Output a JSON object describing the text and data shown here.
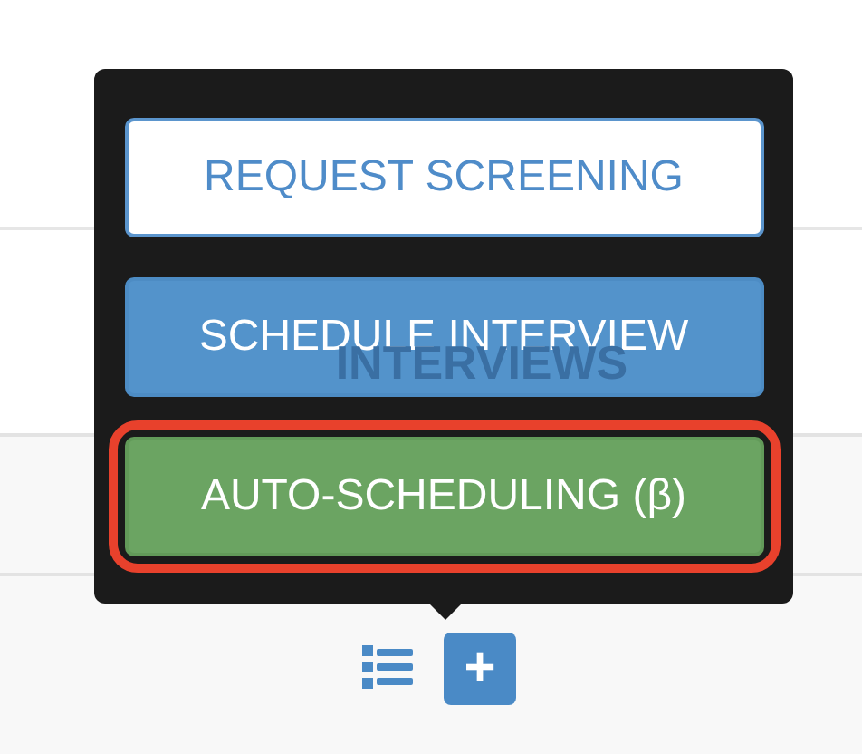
{
  "background": {
    "heading": "INTERVIEWS"
  },
  "popover": {
    "buttons": [
      {
        "label": "REQUEST SCREENING",
        "kind": "outline",
        "highlighted": false
      },
      {
        "label": "SCHEDULE INTERVIEW",
        "kind": "primary",
        "highlighted": false
      },
      {
        "label": "AUTO-SCHEDULING (β)",
        "kind": "success",
        "highlighted": true
      }
    ]
  },
  "toolbar": {
    "add_button": {
      "label": "+"
    }
  }
}
